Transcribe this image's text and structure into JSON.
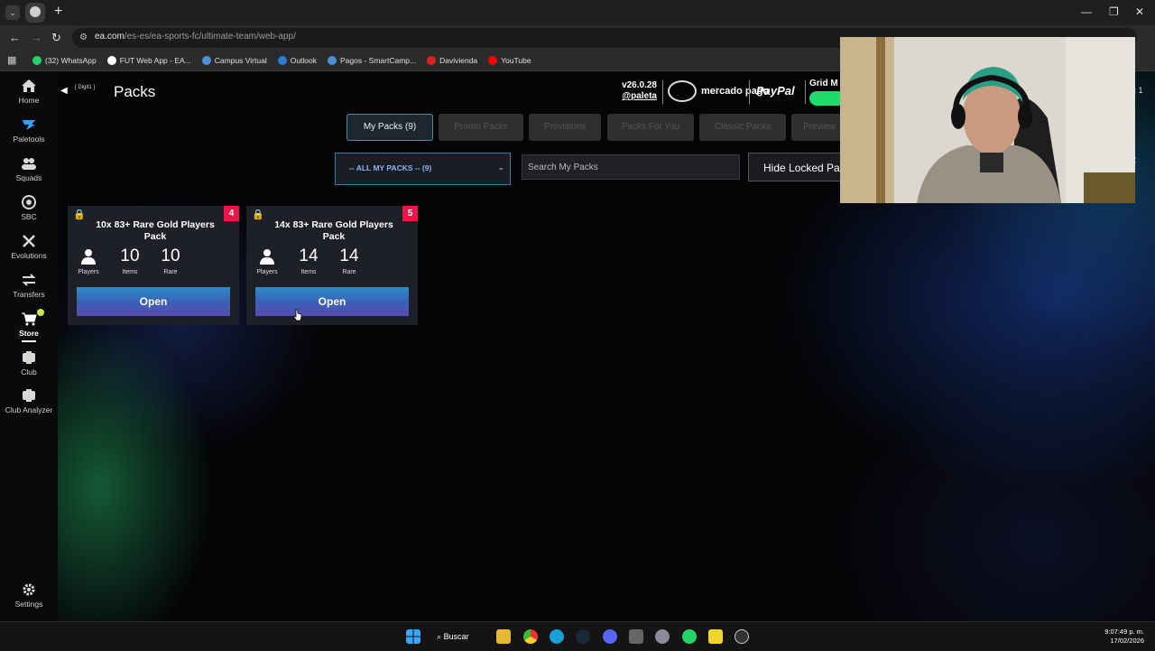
{
  "browser": {
    "url_host": "ea.com",
    "url_path": "/es-es/ea-sports-fc/ultimate-team/web-app/",
    "bookmarks": [
      {
        "label": "(32) WhatsApp",
        "icon": "whatsapp-icon",
        "color": "#25d366"
      },
      {
        "label": "FUT Web App - EA...",
        "icon": "fut-icon",
        "color": "#ffffff"
      },
      {
        "label": "Campus Virtual",
        "icon": "campus-icon",
        "color": "#4a90d9"
      },
      {
        "label": "Outlook",
        "icon": "outlook-icon",
        "color": "#2d7ad6"
      },
      {
        "label": "Pagos - SmartCamp...",
        "icon": "pagos-icon",
        "color": "#4a90d9"
      },
      {
        "label": "Davivienda",
        "icon": "davivienda-icon",
        "color": "#e02020"
      },
      {
        "label": "YouTube",
        "icon": "youtube-icon",
        "color": "#ff0000"
      }
    ]
  },
  "sidebar": {
    "items": [
      {
        "label": "Home",
        "icon": "home-icon"
      },
      {
        "label": "Paletools",
        "icon": "paletools-icon"
      },
      {
        "label": "Squads",
        "icon": "squads-icon"
      },
      {
        "label": "SBC",
        "icon": "sbc-icon"
      },
      {
        "label": "Evolutions",
        "icon": "evolutions-icon"
      },
      {
        "label": "Transfers",
        "icon": "transfers-icon"
      },
      {
        "label": "Store",
        "icon": "store-icon",
        "active": true
      },
      {
        "label": "Club",
        "icon": "club-icon"
      },
      {
        "label": "Club Analyzer",
        "icon": "club-analyzer-icon"
      }
    ],
    "settings_label": "Settings"
  },
  "header": {
    "back_label": "[ Digit1 ]",
    "title": "Packs",
    "version": "v26.0.28",
    "handle": "@paleta",
    "mercado_pago": "mercado pago",
    "paypal": "PayPal",
    "grid_label": "Grid M",
    "grid_toggle_on": true,
    "notif_count": "1"
  },
  "tabs": [
    {
      "label": "My Packs (9)",
      "active": true
    },
    {
      "label": "Promo Packs"
    },
    {
      "label": "Provisions"
    },
    {
      "label": "Packs For You"
    },
    {
      "label": "Classic Packs"
    },
    {
      "label": "Preview"
    }
  ],
  "filters": {
    "dropdown_value": "-- ALL MY PACKS -- (9)",
    "search_placeholder": "Search My Packs",
    "hide_locked_label": "Hide Locked Pa"
  },
  "packs": [
    {
      "title": "10x 83+ Rare Gold Players Pack",
      "badge": "4",
      "stat_players_label": "Players",
      "items_value": "10",
      "items_label": "Items",
      "rare_value": "10",
      "rare_label": "Rare",
      "open_label": "Open"
    },
    {
      "title": "14x 83+ Rare Gold Players Pack",
      "badge": "5",
      "stat_players_label": "Players",
      "items_value": "14",
      "items_label": "Items",
      "rare_value": "14",
      "rare_label": "Rare",
      "open_label": "Open"
    }
  ],
  "taskbar": {
    "search_label": "Buscar",
    "time": "9:07:49 p. m.",
    "date": "17/02/2026"
  },
  "colors": {
    "accent_pink": "#e8194a",
    "open_gradient_top": "#2b8bc8",
    "open_gradient_bottom": "#5a4cb0",
    "toggle_green": "#1fdc6a"
  }
}
